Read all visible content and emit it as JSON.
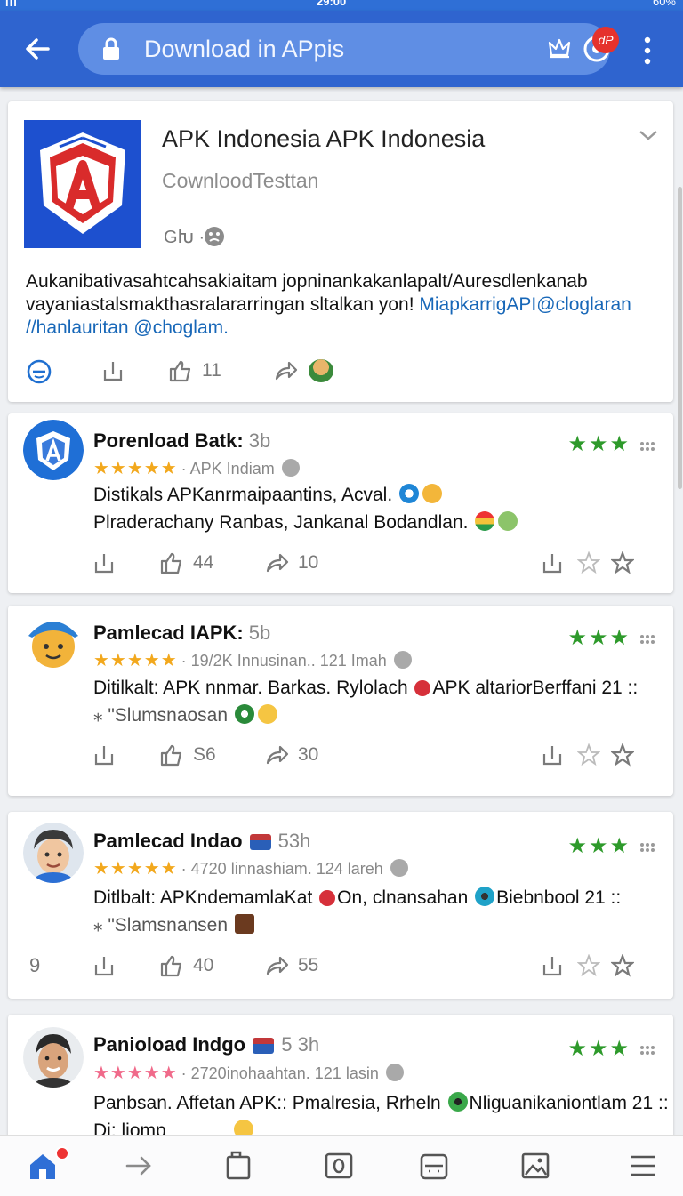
{
  "status": {
    "signal": "ııı",
    "time": "29:00",
    "battery": "60%"
  },
  "urlbar": {
    "text": "Download in APpis",
    "badge": "dP"
  },
  "app": {
    "title": "APK Indonesia APK Indonesia",
    "subtitle": "CownloodTesttan",
    "meta": "GԽ ·",
    "desc_lines": [
      "Aukanibativasahtcahsakiaitam jopninankakanlapalt/Auresdlenkanab",
      "vayaniastalsmakthasralararringan sltalkan yon! ",
      "//hanlauritan @choglam."
    ],
    "desc_link": "MiapkarrigAPI@cloglaran",
    "actions": {
      "likes": "11"
    }
  },
  "reviews": [
    {
      "name": "Porenload Batk:",
      "age": "3b",
      "stars": "★★★★★",
      "meta": "· APK Indiam",
      "line1": "Distikals APKanrmaipaantins, Acval.",
      "line2": "Plraderachany Ranbas, Jankanal Bodandlan.",
      "comments": "44",
      "shares": "10",
      "left_count": ""
    },
    {
      "name": "Pamlecad IAPK:",
      "age": "5b",
      "stars": "★★★★★",
      "meta": "· 19/2K Innusinan.. 121 Imah",
      "line1": "Ditilkalt: APK nnmar. Barkas. Rylolach",
      "line1b": "APK altariorBerffani 21 ::",
      "line2": "⁎ \"Slumsnaosan",
      "comments": "S6",
      "shares": "30",
      "left_count": ""
    },
    {
      "name": "Pamlecad Indao",
      "age": "53h",
      "stars": "★★★★★",
      "meta": "· 4720 linnashiam. 124 lareh",
      "line1": "Ditlbalt: APKndemamlaKat",
      "line1b": "On, clnansahan",
      "line1c": "Biebnbool 21 ::",
      "line2": "⁎ \"Slamsnansen",
      "comments": "40",
      "shares": "55",
      "left_count": "9"
    },
    {
      "name": "Panioload Indgo",
      "age": "5 3h",
      "stars": "★★★★★",
      "meta": "· 2720inohaahtan. 121 lasin",
      "line1": "Panbsan. Affetan APK:: Pmalresia, Rrheln",
      "line1b": "Nliguanikaniontlam 21 ::",
      "line2": "Di: liomp",
      "comments": "",
      "shares": "",
      "left_count": ""
    }
  ],
  "colors": {
    "appbar": "#2f64cf",
    "urlbar": "#5f8ee4",
    "green_star": "#2e9a2b",
    "gold_star": "#f2a81d",
    "link": "#1767b8"
  }
}
